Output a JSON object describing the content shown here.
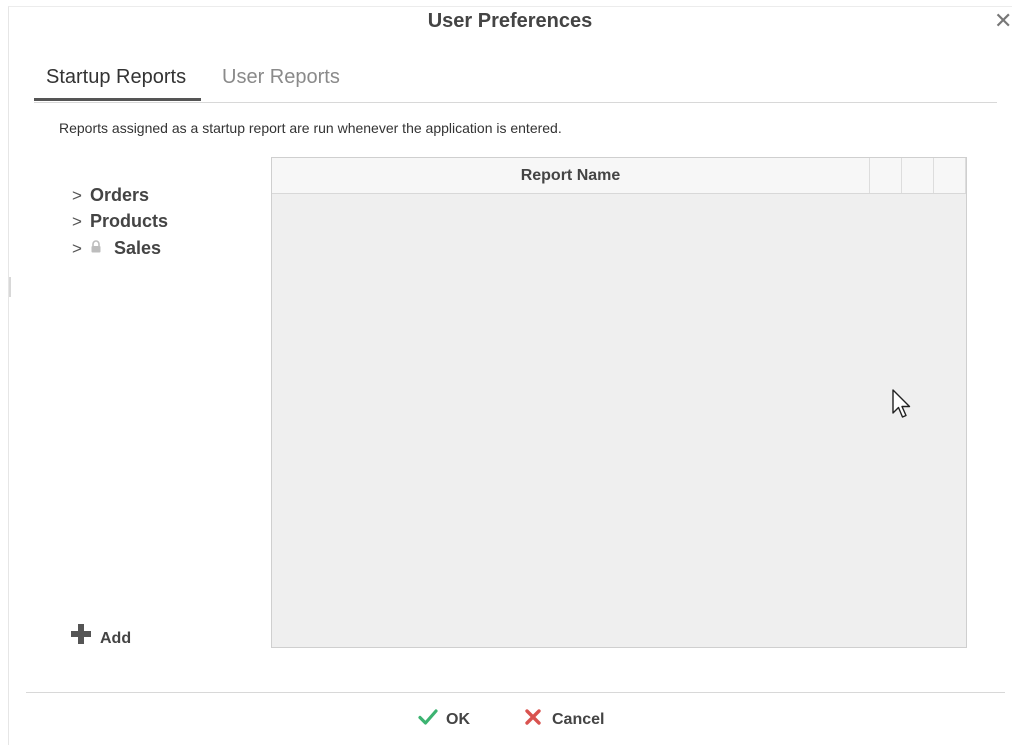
{
  "dialog": {
    "title": "User Preferences",
    "close_label": "✕"
  },
  "tabs": [
    {
      "label": "Startup Reports",
      "active": true
    },
    {
      "label": "User Reports",
      "active": false
    }
  ],
  "description": "Reports assigned as a startup report are run whenever the application is entered.",
  "tree": {
    "items": [
      {
        "label": "Orders",
        "icon": "chevron-right-icon",
        "locked": false
      },
      {
        "label": "Products",
        "icon": "chevron-right-icon",
        "locked": false
      },
      {
        "label": "Sales",
        "icon": "chevron-right-icon",
        "locked": true
      }
    ]
  },
  "add_button": {
    "label": "Add",
    "icon": "plus-icon"
  },
  "grid": {
    "columns": [
      "Report Name",
      "",
      "",
      ""
    ],
    "rows": []
  },
  "footer": {
    "ok_label": "OK",
    "cancel_label": "Cancel",
    "ok_color": "#3cb371",
    "cancel_color": "#d9534f"
  }
}
